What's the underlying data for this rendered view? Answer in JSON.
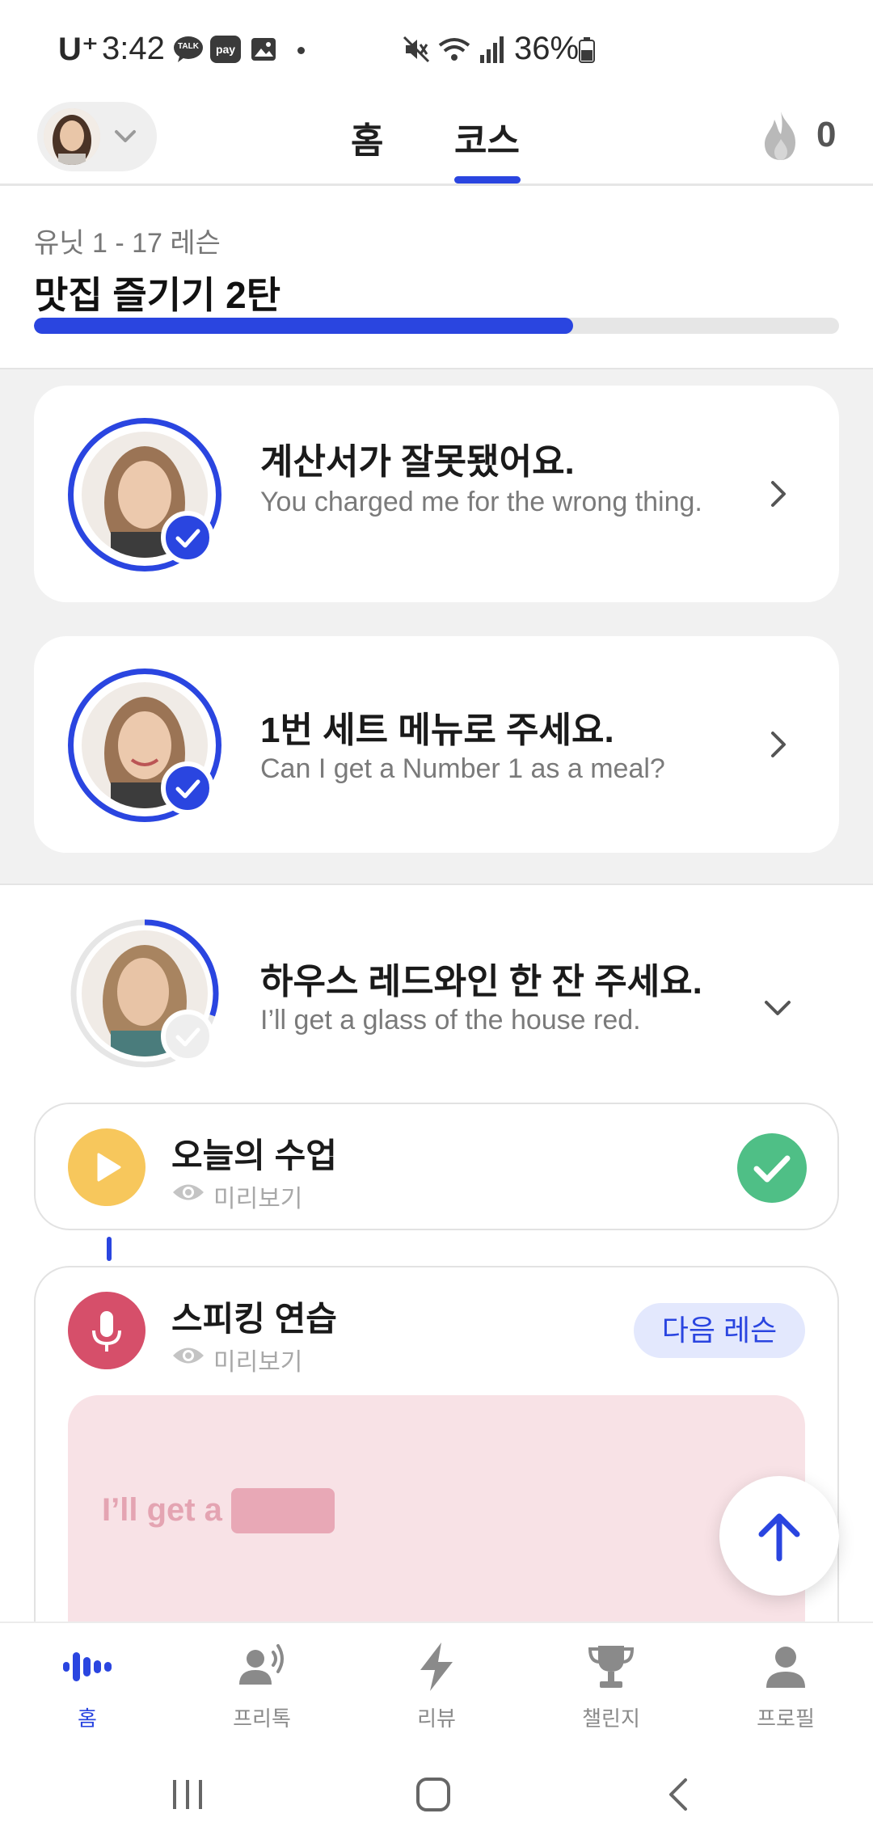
{
  "status_bar": {
    "carrier": "U⁺",
    "time": "3:42",
    "chip_talk": "TALK",
    "chip_pay": "pay",
    "battery": "36%"
  },
  "header": {
    "tabs": [
      {
        "label": "홈",
        "active": false
      },
      {
        "label": "코스",
        "active": true
      }
    ],
    "streak_count": "0",
    "accent_color": "#2a45e0"
  },
  "unit": {
    "subtitle": "유닛 1 - 17 레슨",
    "title": "맛집 즐기기 2탄",
    "progress_fraction": 0.67
  },
  "lessons": [
    {
      "title": "계산서가 잘못됐어요.",
      "subtitle": "You charged me for the wrong thing.",
      "completed": true,
      "icon": "chevron-right-icon"
    },
    {
      "title": "1번 세트 메뉴로 주세요.",
      "subtitle": "Can I get a Number 1 as a meal?",
      "completed": true,
      "icon": "chevron-right-icon"
    },
    {
      "title": "하우스 레드와인 한 잔 주세요.",
      "subtitle": "I’ll get a glass of the house red.",
      "completed": false,
      "icon": "chevron-down-icon",
      "ring_progress_fraction": 0.3
    }
  ],
  "activities": [
    {
      "title": "오늘의 수업",
      "preview": "미리보기",
      "status": "done",
      "icon": "play-icon",
      "icon_color": "#f7c75c"
    },
    {
      "title": "스피킹 연습",
      "preview": "미리보기",
      "status": "next",
      "status_label": "다음 레슨",
      "icon": "microphone-icon",
      "icon_color": "#d64f6a"
    }
  ],
  "speaking_preview": {
    "text": "I’ll get a"
  },
  "bottom_nav": [
    {
      "label": "홈",
      "icon": "voice-wave-icon",
      "active": true
    },
    {
      "label": "프리톡",
      "icon": "speaking-person-icon",
      "active": false
    },
    {
      "label": "리뷰",
      "icon": "lightning-icon",
      "active": false
    },
    {
      "label": "챌린지",
      "icon": "trophy-icon",
      "active": false
    },
    {
      "label": "프로필",
      "icon": "person-icon",
      "active": false
    }
  ]
}
